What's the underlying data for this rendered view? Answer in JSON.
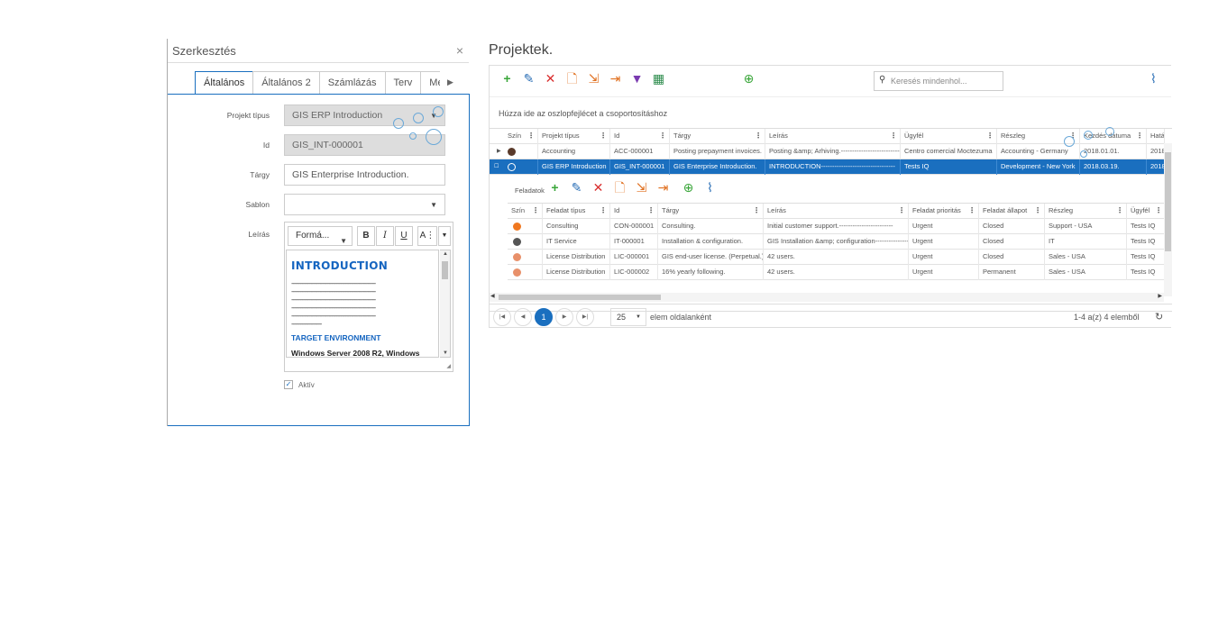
{
  "edit_panel": {
    "title": "Szerkesztés",
    "close": "×",
    "tabs": [
      {
        "label": "Általános",
        "active": true
      },
      {
        "label": "Általános 2"
      },
      {
        "label": "Számlázás"
      },
      {
        "label": "Terv"
      },
      {
        "label": "Megj"
      }
    ],
    "fields": {
      "project_type": {
        "label": "Projekt típus",
        "value": "GIS ERP Introduction"
      },
      "id": {
        "label": "Id",
        "value": "GIS_INT-000001"
      },
      "subject": {
        "label": "Tárgy",
        "value": "GIS Enterprise Introduction."
      },
      "template": {
        "label": "Sablon",
        "value": ""
      },
      "description": {
        "label": "Leírás"
      }
    },
    "editor": {
      "format_label": "Formá...",
      "bold": "B",
      "italic": "I",
      "underline": "U",
      "font_color": "A",
      "heading": "INTRODUCTION",
      "dashes": [
        "--------------------------------------------------------",
        "--------------------------------------------------------",
        "--------------------------------------------------------",
        "--------------------------------------------------------",
        "--------------------------------------------------------",
        "--------------------"
      ],
      "subheading": "TARGET ENVIRONMENT",
      "paragraph": "Windows Server 2008 R2, Windows"
    },
    "active": {
      "label": "Aktív",
      "checked": true
    }
  },
  "projects": {
    "title": "Projektek.",
    "search_placeholder": "Keresés mindenhol...",
    "group_hint": "Húzza ide az oszlopfejlécet a csoportosításhoz",
    "columns": [
      "Szín",
      "Projekt típus",
      "Id",
      "Tárgy",
      "Leírás",
      "Ügyfél",
      "Részleg",
      "Kezdés dátuma",
      "Hatá"
    ],
    "rows": [
      {
        "color": "#5a3a2a",
        "type": "Accounting",
        "id": "ACC-000001",
        "subject": "Posting prepayment invoices.",
        "desc": "Posting &amp; Arhiving.---------------------------",
        "client": "Centro comercial Moctezuma",
        "dept": "Accounting - Germany",
        "start": "2018.01.01.",
        "end": "2018"
      },
      {
        "color": "#1a6fbf",
        "type": "GIS ERP Introduction",
        "id": "GIS_INT-000001",
        "subject": "GIS Enterprise Introduction.",
        "desc": "INTRODUCTION---------------------------------",
        "client": "Tests IQ",
        "dept": "Development - New York",
        "start": "2018.03.19.",
        "end": "2018",
        "selected": true
      }
    ],
    "detail": {
      "label": "Feladatok",
      "columns": [
        "Szín",
        "Feladat típus",
        "Id",
        "Tárgy",
        "Leírás",
        "Feladat prioritás",
        "Feladat állapot",
        "Részleg",
        "Ügyfél"
      ],
      "rows": [
        {
          "color": "#f07820",
          "type": "Consulting",
          "id": "CON-000001",
          "subject": "Consulting.",
          "desc": "Initial customer support.------------------------",
          "priority": "Urgent",
          "status": "Closed",
          "dept": "Support - USA",
          "client": "Tests IQ"
        },
        {
          "color": "#555555",
          "type": "IT Service",
          "id": "IT-000001",
          "subject": "Installation & configuration.",
          "desc": "GIS Installation &amp; configuration---------------",
          "priority": "Urgent",
          "status": "Closed",
          "dept": "IT",
          "client": "Tests IQ"
        },
        {
          "color": "#e8906a",
          "type": "License Distribution",
          "id": "LIC-000001",
          "subject": "GIS end-user license. (Perpetual.)",
          "desc": "42 users.",
          "priority": "Urgent",
          "status": "Closed",
          "dept": "Sales - USA",
          "client": "Tests IQ"
        },
        {
          "color": "#e8906a",
          "type": "License Distribution",
          "id": "LIC-000002",
          "subject": "16% yearly following.",
          "desc": "42 users.",
          "priority": "Urgent",
          "status": "Permanent",
          "dept": "Sales - USA",
          "client": "Tests IQ"
        }
      ]
    },
    "pager": {
      "current_page": "1",
      "page_size": "25",
      "per_page_label": "elem oldalanként",
      "items_info": "1-4 a(z) 4 elemből"
    }
  }
}
